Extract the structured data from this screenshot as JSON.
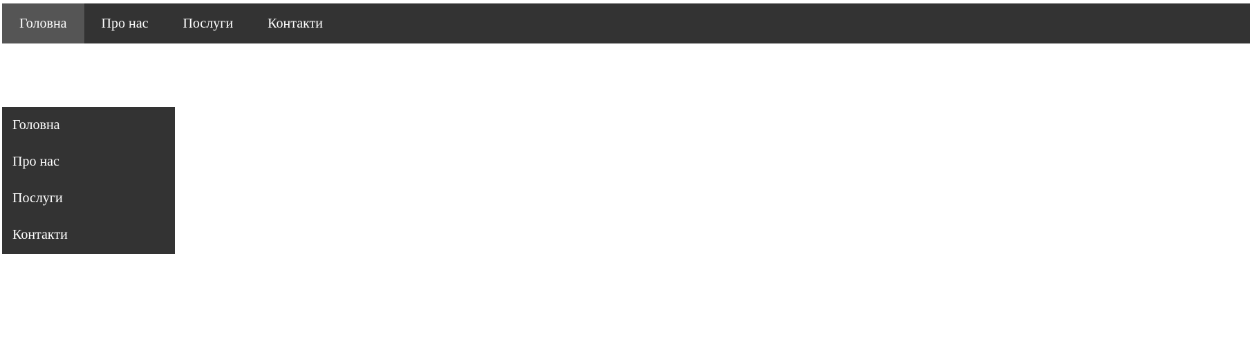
{
  "topnav": {
    "items": [
      {
        "label": "Головна",
        "active": true
      },
      {
        "label": "Про нас",
        "active": false
      },
      {
        "label": "Послуги",
        "active": false
      },
      {
        "label": "Контакти",
        "active": false
      }
    ]
  },
  "sidenav": {
    "items": [
      {
        "label": "Головна"
      },
      {
        "label": "Про нас"
      },
      {
        "label": "Послуги"
      },
      {
        "label": "Контакти"
      }
    ]
  },
  "colors": {
    "nav_background": "#333333",
    "active_background": "#555555",
    "nav_text": "#ffffff",
    "page_background": "#ffffff"
  }
}
